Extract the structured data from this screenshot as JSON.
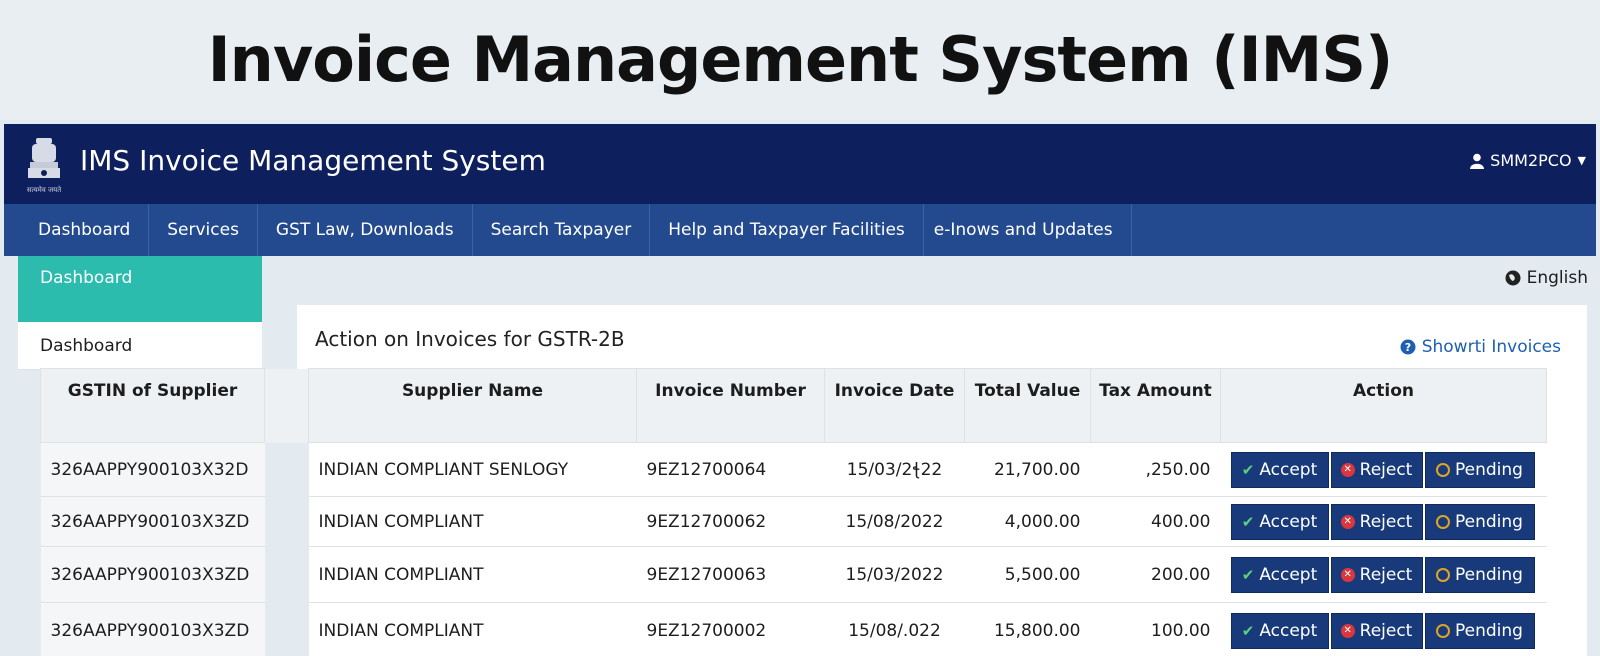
{
  "banner": {
    "title": "Invoice Management System (IMS)"
  },
  "header": {
    "app_title": "IMS Invoice Management System",
    "username": "SMM2PCO",
    "emblem_caption": "सत्यमेव जयते"
  },
  "nav": {
    "items": [
      "Dashboard",
      "Services",
      "GST Law, Downloads",
      "Search Taxpayer",
      "Help and Taxpayer Facilities",
      "e-Inows and Updates"
    ]
  },
  "sidebar": {
    "active_label": "Dashboard",
    "items": [
      "Dashboard"
    ]
  },
  "language": "English",
  "panel": {
    "title": "Action on Invoices for GSTR-2B",
    "show_link": "Showrti Invoices"
  },
  "table": {
    "headers": {
      "gstin": "GSTIN of Supplier",
      "name": "Supplier Name",
      "invoice": "Invoice Number",
      "date": "Invoice Date",
      "total": "Total Value",
      "tax": "Tax Amount",
      "action": "Action"
    },
    "rows": [
      {
        "gstin": "326AAPPY900103X32D",
        "name": "INDIAN COMPLIANT SENLOGY",
        "invoice": "9EZ12700064",
        "date": "15/03/2ꞎ22",
        "total": "21,700.00",
        "tax": ",250.00"
      },
      {
        "gstin": "326AAPPY900103X3ZD",
        "name": "INDIAN COMPLIANT",
        "invoice": "9EZ12700062",
        "date": "15/08/2022",
        "total": "4,000.00",
        "tax": "400.00"
      },
      {
        "gstin": "326AAPPY900103X3ZD",
        "name": "INDIAN COMPLIANT",
        "invoice": "9EZ12700063",
        "date": "15/03/2022",
        "total": "5,500.00",
        "tax": "200.00"
      },
      {
        "gstin": "326AAPPY900103X3ZD",
        "name": "INDIAN COMPLIANT",
        "invoice": "9EZ12700002",
        "date": "15/08/.022",
        "total": "15,800.00",
        "tax": "100.00"
      }
    ],
    "actions": {
      "accept": "Accept",
      "reject": "Reject",
      "pending": "Pending"
    }
  },
  "colors": {
    "header_bg": "#0d1f5c",
    "nav_bg": "#234a8e",
    "sidebar_active": "#2bbcae",
    "button_bg": "#183a7a",
    "link": "#1e5fb3"
  },
  "icons": [
    "emblem-icon",
    "user-icon",
    "caret-down-icon",
    "globe-icon",
    "question-icon",
    "check-icon",
    "reject-icon",
    "clock-icon",
    "scroll-up-icon"
  ]
}
